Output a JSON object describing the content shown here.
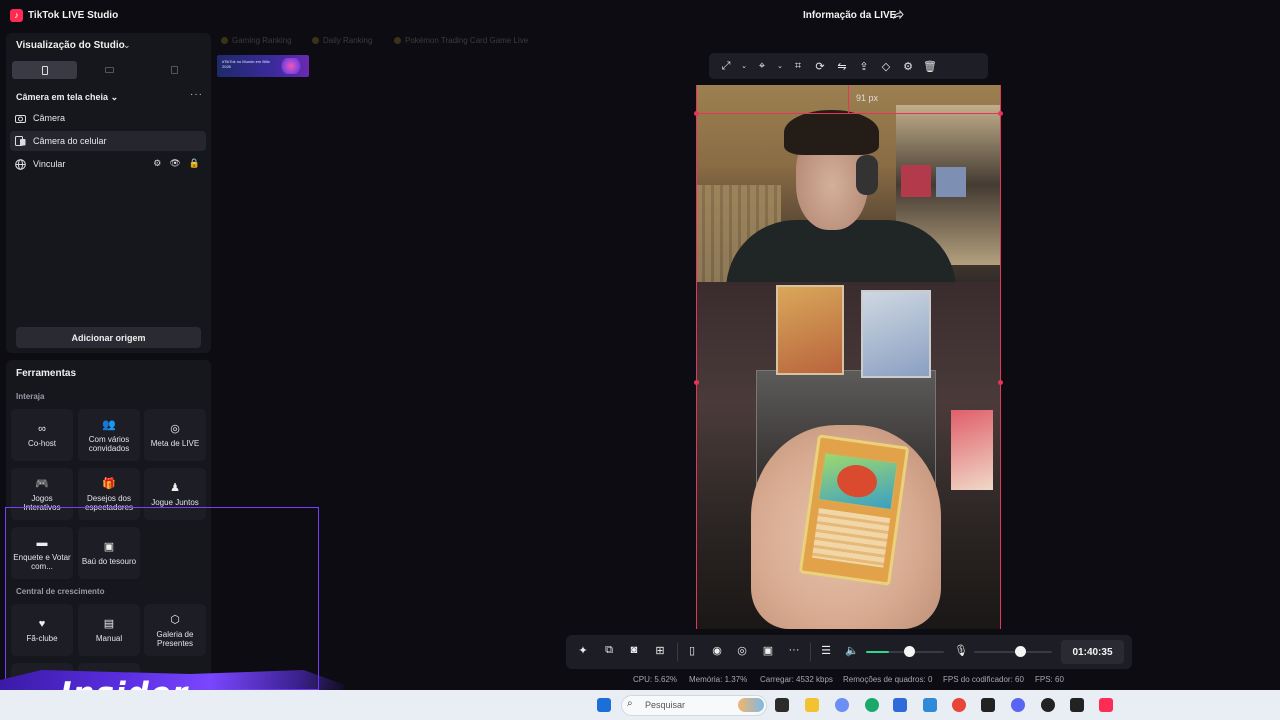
{
  "app": {
    "title": "TikTok LIVE Studio",
    "live_info": "Informação da LIVE"
  },
  "sources_panel": {
    "title": "Visualização do Studio",
    "scene": "Câmera em tela cheia",
    "items": [
      {
        "label": "Câmera",
        "icon": "camera-icon"
      },
      {
        "label": "Câmera do celular",
        "icon": "phone-camera-icon",
        "selected": true
      },
      {
        "label": "Vincular",
        "icon": "globe-icon"
      }
    ],
    "add_label": "Adicionar origem"
  },
  "tools_panel": {
    "title": "Ferramentas",
    "interact_label": "Interaja",
    "interact_tools": [
      "Co-host",
      "Com vários convidados",
      "Meta de LIVE",
      "Jogos Interativos",
      "Desejos dos espectadores",
      "Jogue Juntos",
      "Enquete e Votar com...",
      "Baú do tesouro"
    ],
    "growth_label": "Central de crescimento",
    "growth_tools": [
      "Fã-clube",
      "Manual",
      "Galeria de Presentes"
    ]
  },
  "tabs": [
    "Gaming Ranking",
    "Daily Ranking",
    "Pokémon Trading Card Game Live"
  ],
  "promo": {
    "text": "#TikTok no Mundo em Blitz 2026"
  },
  "preview": {
    "guide_label": "91 px"
  },
  "controls": {
    "timer": "01:40:35",
    "volume_level": 0.3
  },
  "status_bar": {
    "cpu": "CPU: 5.62%",
    "memory": "Memória: 1.37%",
    "upload": "Carregar: 4532 kbps",
    "dropped": "Remoções de quadros: 0",
    "encoder_fps": "FPS do codificador: 60",
    "fps": "FPS: 60"
  },
  "overlay": {
    "brand": "Insider"
  },
  "taskbar": {
    "search_placeholder": "Pesquisar"
  },
  "colors": {
    "accent": "#fe2c55",
    "guide": "#e8345a",
    "volume": "#2bd98a",
    "frame": "#7a3cff"
  }
}
